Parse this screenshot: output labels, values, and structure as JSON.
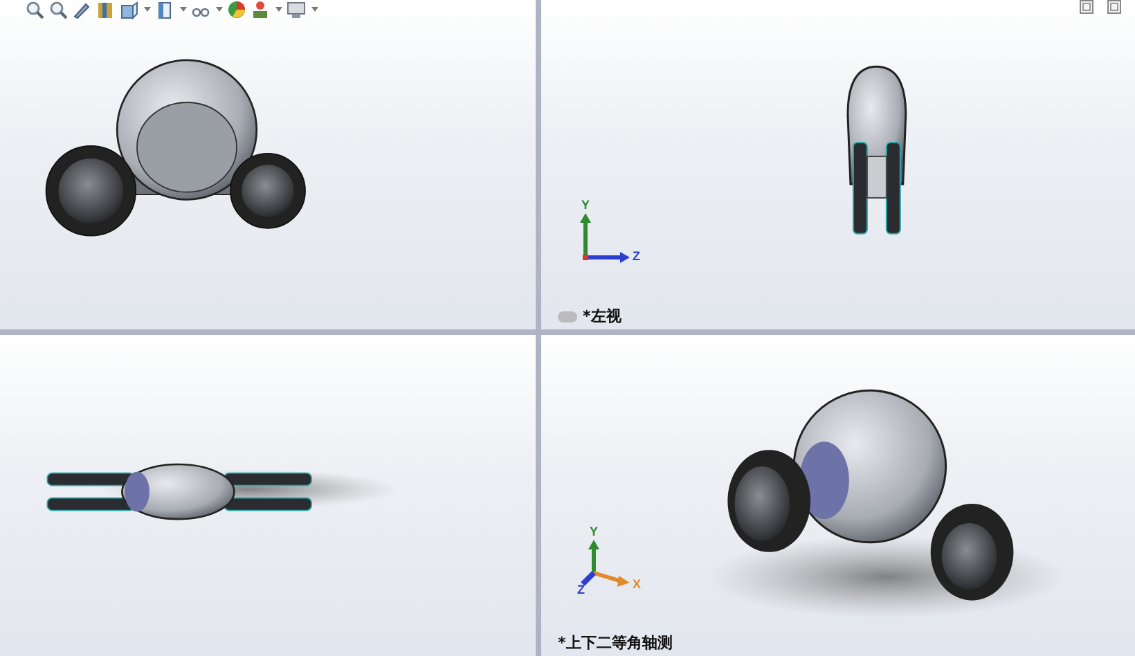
{
  "toolbar": {
    "tools": [
      {
        "kind": "zoom-fit",
        "dropdown": false
      },
      {
        "kind": "zoom-area",
        "dropdown": false
      },
      {
        "kind": "previous-view",
        "dropdown": false
      },
      {
        "kind": "section-view",
        "dropdown": false
      },
      {
        "kind": "view-orientation",
        "dropdown": true
      },
      {
        "kind": "display-style",
        "dropdown": true
      },
      {
        "kind": "hide-show",
        "dropdown": true
      },
      {
        "kind": "edit-appearance",
        "dropdown": false
      },
      {
        "kind": "apply-scene",
        "dropdown": true
      },
      {
        "kind": "view-settings",
        "dropdown": true
      }
    ]
  },
  "window_controls": [
    {
      "kind": "tile"
    },
    {
      "kind": "tile"
    }
  ],
  "viewports": [
    {
      "kind": "front"
    },
    {
      "kind": "left",
      "label": "*左视",
      "triad": {
        "kind": "yz",
        "y": "Y",
        "z": "Z"
      }
    },
    {
      "kind": "top"
    },
    {
      "kind": "iso",
      "label": "*上下二等角轴测",
      "triad": {
        "kind": "iso",
        "y": "Y",
        "x": "X",
        "z": "Z"
      }
    }
  ]
}
